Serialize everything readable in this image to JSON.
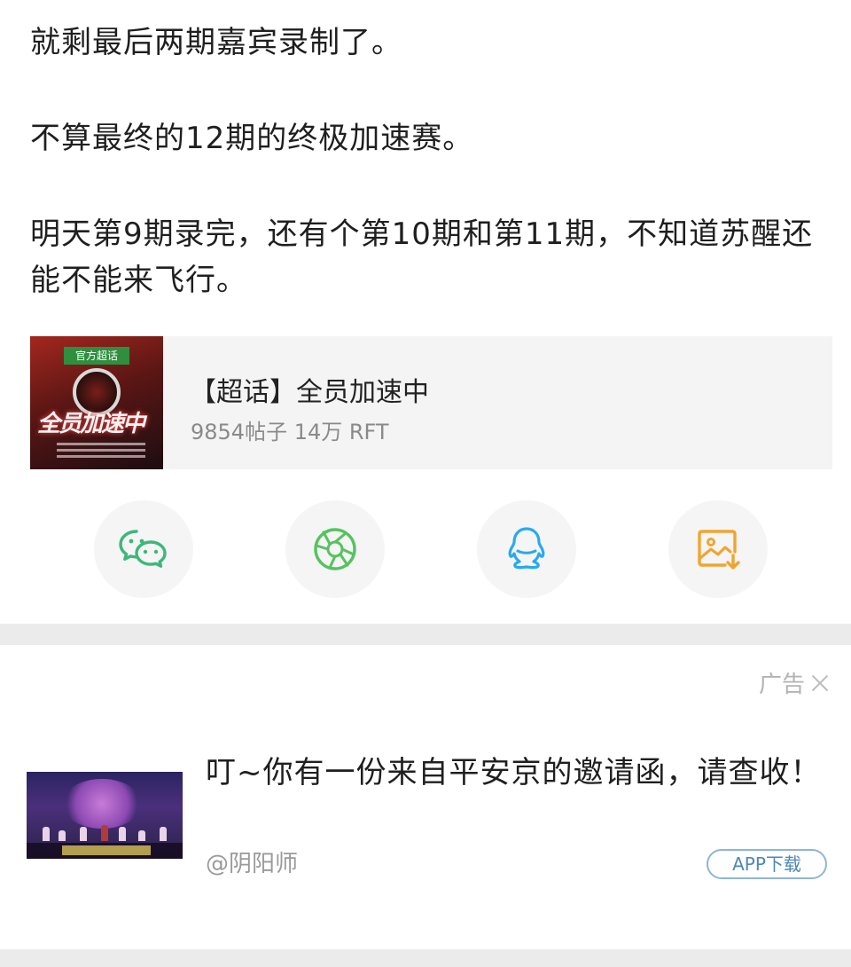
{
  "post": {
    "paragraphs": [
      "就剩最后两期嘉宾录制了。",
      "不算最终的12期的终极加速赛。",
      "明天第9期录完，还有个第10期和第11期，不知道苏醒还能不能来飞行。"
    ]
  },
  "topic_card": {
    "thumb_badge": "官方超话",
    "thumb_title": "全员加速中",
    "title": "【超话】全员加速中",
    "stats": "9854帖子 14万 RFT"
  },
  "share": {
    "icons": [
      "wechat-icon",
      "moments-icon",
      "qq-icon",
      "save-image-icon"
    ],
    "colors": {
      "wechat": "#3cb879",
      "moments": "#55c35f",
      "qq": "#29a9f0",
      "save": "#f0a531"
    }
  },
  "ad": {
    "label": "广告",
    "title": "叮~你有一份来自平安京的邀请函，请查收！",
    "source": "@阴阳师",
    "button": "APP下载"
  }
}
